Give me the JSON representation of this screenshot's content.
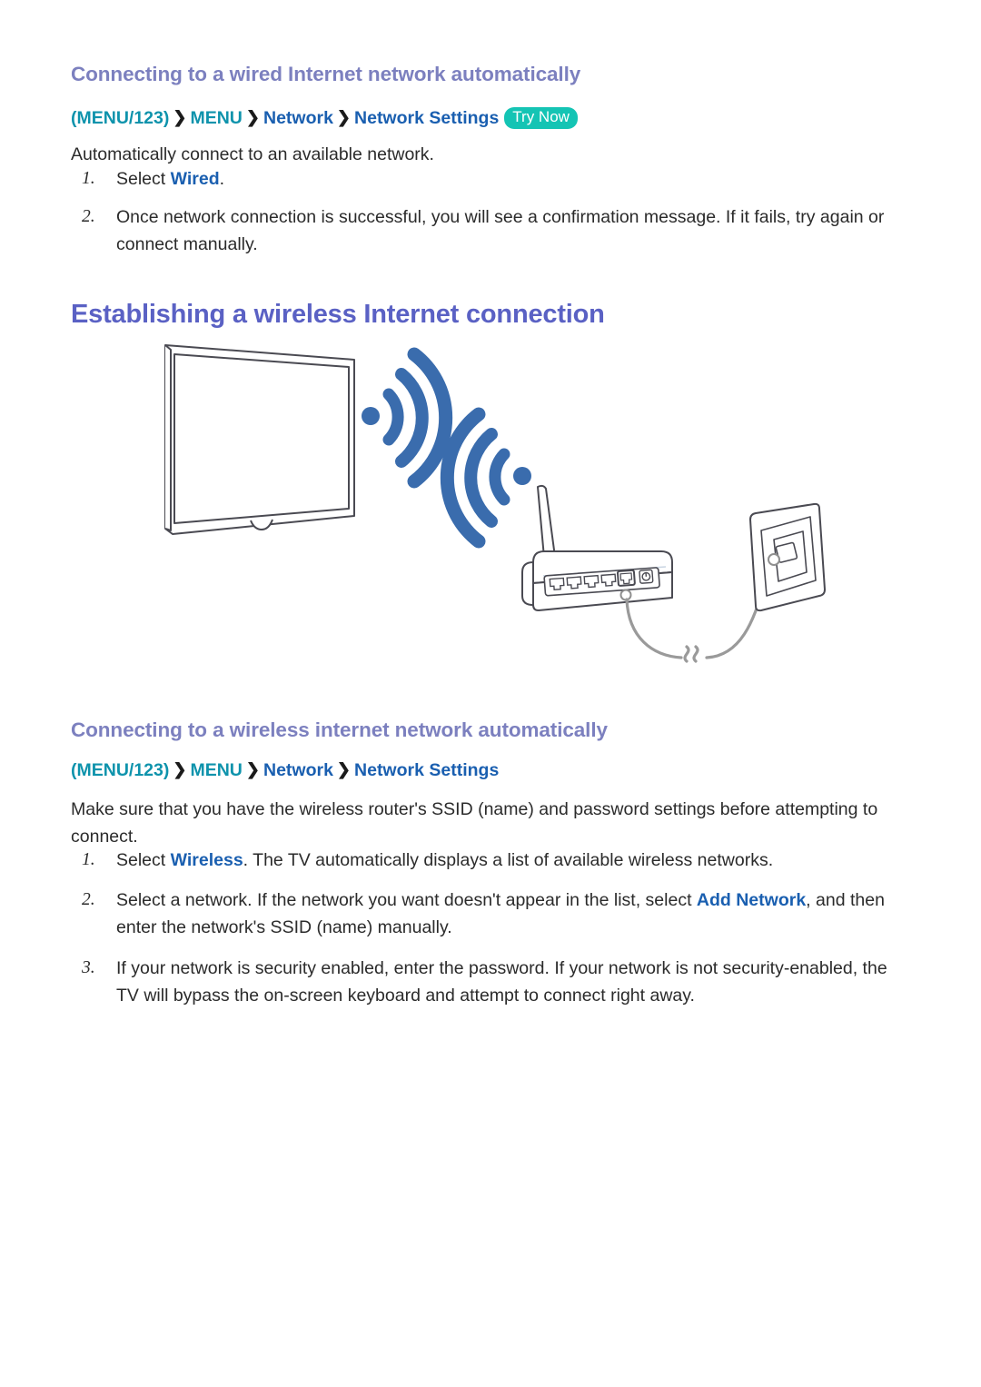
{
  "document": {
    "type": "tv-e-manual-page",
    "background": "#ffffff"
  },
  "colors": {
    "subheading": "#7c80bf",
    "heading": "#5a61c4",
    "breadcrumb_teal": "#0e93ac",
    "breadcrumb_blue": "#1a5fb0",
    "breadcrumb_separator": "#1b1b1b",
    "try_now_badge_bg": "#14c4b4",
    "try_now_badge_text": "#ffffff",
    "body_text": "#2b2b2b",
    "link_highlight": "#1a5fb0",
    "wifi_signal": "#3a6cad",
    "line_art_stroke": "#4a4a52",
    "cable_stroke": "#9a9a9a"
  },
  "section1": {
    "heading": "Connecting to a wired Internet network automatically",
    "breadcrumb": {
      "open_paren": "(",
      "menu123": "MENU/123",
      "close_paren": ")",
      "separator": "❯",
      "menu": "MENU",
      "network": "Network",
      "network_settings": "Network Settings",
      "try_now": "Try Now"
    },
    "intro": "Automatically connect to an available network.",
    "steps": [
      {
        "number": "1.",
        "prefix": "Select ",
        "highlight": "Wired",
        "suffix": "."
      },
      {
        "number": "2.",
        "prefix": "Once network connection is successful, you will see a confirmation message. If it fails, try again or connect manually.",
        "highlight": "",
        "suffix": ""
      }
    ]
  },
  "main_heading": "Establishing a wireless Internet connection",
  "figure": {
    "name": "wireless-internet-connection-illustration",
    "elements": [
      "television",
      "wifi-signal-from-tv",
      "wifi-signal-from-router",
      "wireless-router",
      "router-antenna",
      "router-lan-ports",
      "router-wan-port",
      "router-power-port",
      "ethernet-cable",
      "wall-outlet-plate"
    ]
  },
  "section2": {
    "heading": "Connecting to a wireless internet network automatically",
    "breadcrumb": {
      "open_paren": "(",
      "menu123": "MENU/123",
      "close_paren": ")",
      "separator": "❯",
      "menu": "MENU",
      "network": "Network",
      "network_settings": "Network Settings"
    },
    "intro": "Make sure that you have the wireless router's SSID (name) and password settings before attempting to connect.",
    "steps": [
      {
        "number": "1.",
        "prefix": "Select ",
        "highlight": "Wireless",
        "suffix": ". The TV automatically displays a list of available wireless networks."
      },
      {
        "number": "2.",
        "prefix": "Select a network. If the network you want doesn't appear in the list, select ",
        "highlight": "Add Network",
        "suffix": ", and then enter the network's SSID (name) manually."
      },
      {
        "number": "3.",
        "prefix": "If your network is security enabled, enter the password. If your network is not security-enabled, the TV will bypass the on-screen keyboard and attempt to connect right away.",
        "highlight": "",
        "suffix": ""
      }
    ]
  }
}
